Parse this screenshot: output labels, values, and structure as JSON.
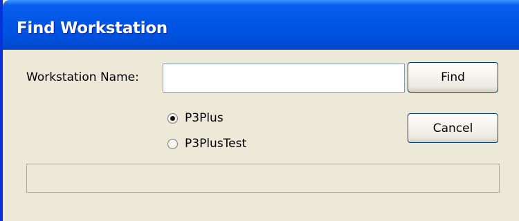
{
  "window": {
    "title": "Find Workstation"
  },
  "form": {
    "workstation_label": "Workstation Name:",
    "workstation_value": "",
    "workstation_placeholder": ""
  },
  "buttons": {
    "find_label": "Find",
    "cancel_label": "Cancel"
  },
  "radios": [
    {
      "label": "P3Plus",
      "checked": true
    },
    {
      "label": "P3PlusTest",
      "checked": false
    }
  ],
  "status": {
    "text": ""
  },
  "colors": {
    "titlebar": "#0054e3",
    "window_face": "#ece9d8",
    "button_border": "#003c74"
  }
}
